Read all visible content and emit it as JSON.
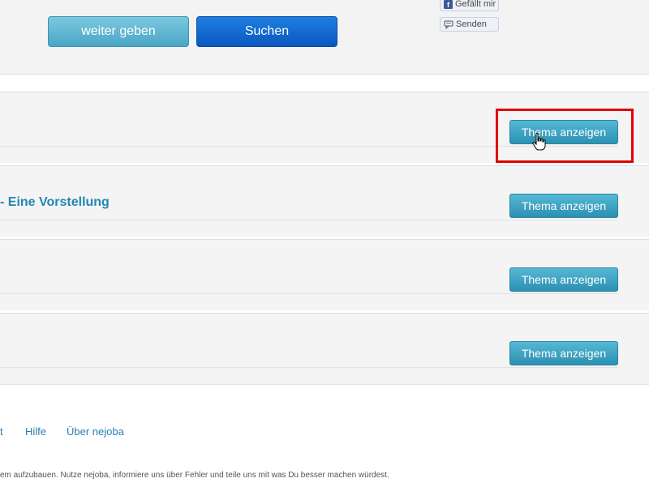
{
  "header": {
    "forward_label": "weiter geben",
    "search_label": "Suchen"
  },
  "social": {
    "like_label": "Gefällt mir",
    "send_label": "Senden"
  },
  "threads": [
    {
      "title": "",
      "button_label": "Thema anzeigen"
    },
    {
      "title": "- Eine Vorstellung",
      "button_label": "Thema anzeigen"
    },
    {
      "title": "",
      "button_label": "Thema anzeigen"
    },
    {
      "title": "",
      "button_label": "Thema anzeigen"
    }
  ],
  "footer": {
    "links": [
      "t",
      "Hilfe",
      "Über nejoba"
    ],
    "text": "em aufzubauen. Nutze nejoba, informiere uns über Fehler und teile uns mit was Du besser machen würdest."
  },
  "colors": {
    "accent": "#2187b3",
    "highlight": "#e00000"
  }
}
